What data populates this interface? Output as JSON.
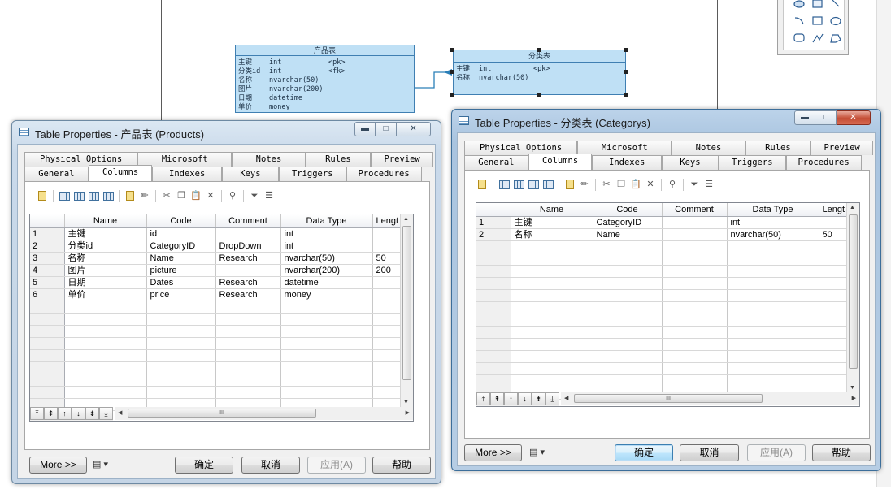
{
  "diagram": {
    "entity_products": {
      "title": "产品表",
      "rows": [
        {
          "name": "主键",
          "type": "int",
          "key": "<pk>"
        },
        {
          "name": "分类id",
          "type": "int",
          "key": "<fk>"
        },
        {
          "name": "名称",
          "type": "nvarchar(50)",
          "key": ""
        },
        {
          "name": "图片",
          "type": "nvarchar(200)",
          "key": ""
        },
        {
          "name": "日期",
          "type": "datetime",
          "key": ""
        },
        {
          "name": "单价",
          "type": "money",
          "key": ""
        }
      ]
    },
    "entity_category": {
      "title": "分类表",
      "rows": [
        {
          "name": "主键",
          "type": "int",
          "key": "<pk>"
        },
        {
          "name": "名称",
          "type": "nvarchar(50)",
          "key": ""
        }
      ]
    },
    "colors": {
      "entity_fill": "#bfe0f5",
      "entity_border": "#3f7fb2",
      "link": "#2a7fb8"
    }
  },
  "tab_labels": {
    "row1": [
      "Physical Options",
      "Microsoft",
      "Notes",
      "Rules",
      "Preview"
    ],
    "row2": [
      "General",
      "Columns",
      "Indexes",
      "Keys",
      "Triggers",
      "Procedures"
    ]
  },
  "grid_headers": [
    "Name",
    "Code",
    "Comment",
    "Data Type",
    "Lengt"
  ],
  "buttons": {
    "more": "More >>",
    "ok": "确定",
    "cancel": "取消",
    "apply": "应用(A)",
    "help": "帮助"
  },
  "scroll_grip": "III",
  "dialog_products": {
    "title": "Table Properties - 产品表 (Products)",
    "selected_tab": "Columns",
    "rows": [
      {
        "n": "1",
        "name": "主键",
        "code": "id",
        "comment": "",
        "type": "int",
        "len": ""
      },
      {
        "n": "2",
        "name": "分类id",
        "code": "CategoryID",
        "comment": "DropDown",
        "type": "int",
        "len": ""
      },
      {
        "n": "3",
        "name": "名称",
        "code": "Name",
        "comment": "Research",
        "type": "nvarchar(50)",
        "len": "50"
      },
      {
        "n": "4",
        "name": "图片",
        "code": "picture",
        "comment": "",
        "type": "nvarchar(200)",
        "len": "200"
      },
      {
        "n": "5",
        "name": "日期",
        "code": "Dates",
        "comment": "Research",
        "type": "datetime",
        "len": ""
      },
      {
        "n": "6",
        "name": "单价",
        "code": "price",
        "comment": "Research",
        "type": "money",
        "len": ""
      }
    ]
  },
  "dialog_category": {
    "title": "Table Properties - 分类表 (Categorys)",
    "selected_tab": "Columns",
    "rows": [
      {
        "n": "1",
        "name": "主键",
        "code": "CategoryID",
        "comment": "",
        "type": "int",
        "len": ""
      },
      {
        "n": "2",
        "name": "名称",
        "code": "Name",
        "comment": "",
        "type": "nvarchar(50)",
        "len": "50"
      }
    ]
  }
}
